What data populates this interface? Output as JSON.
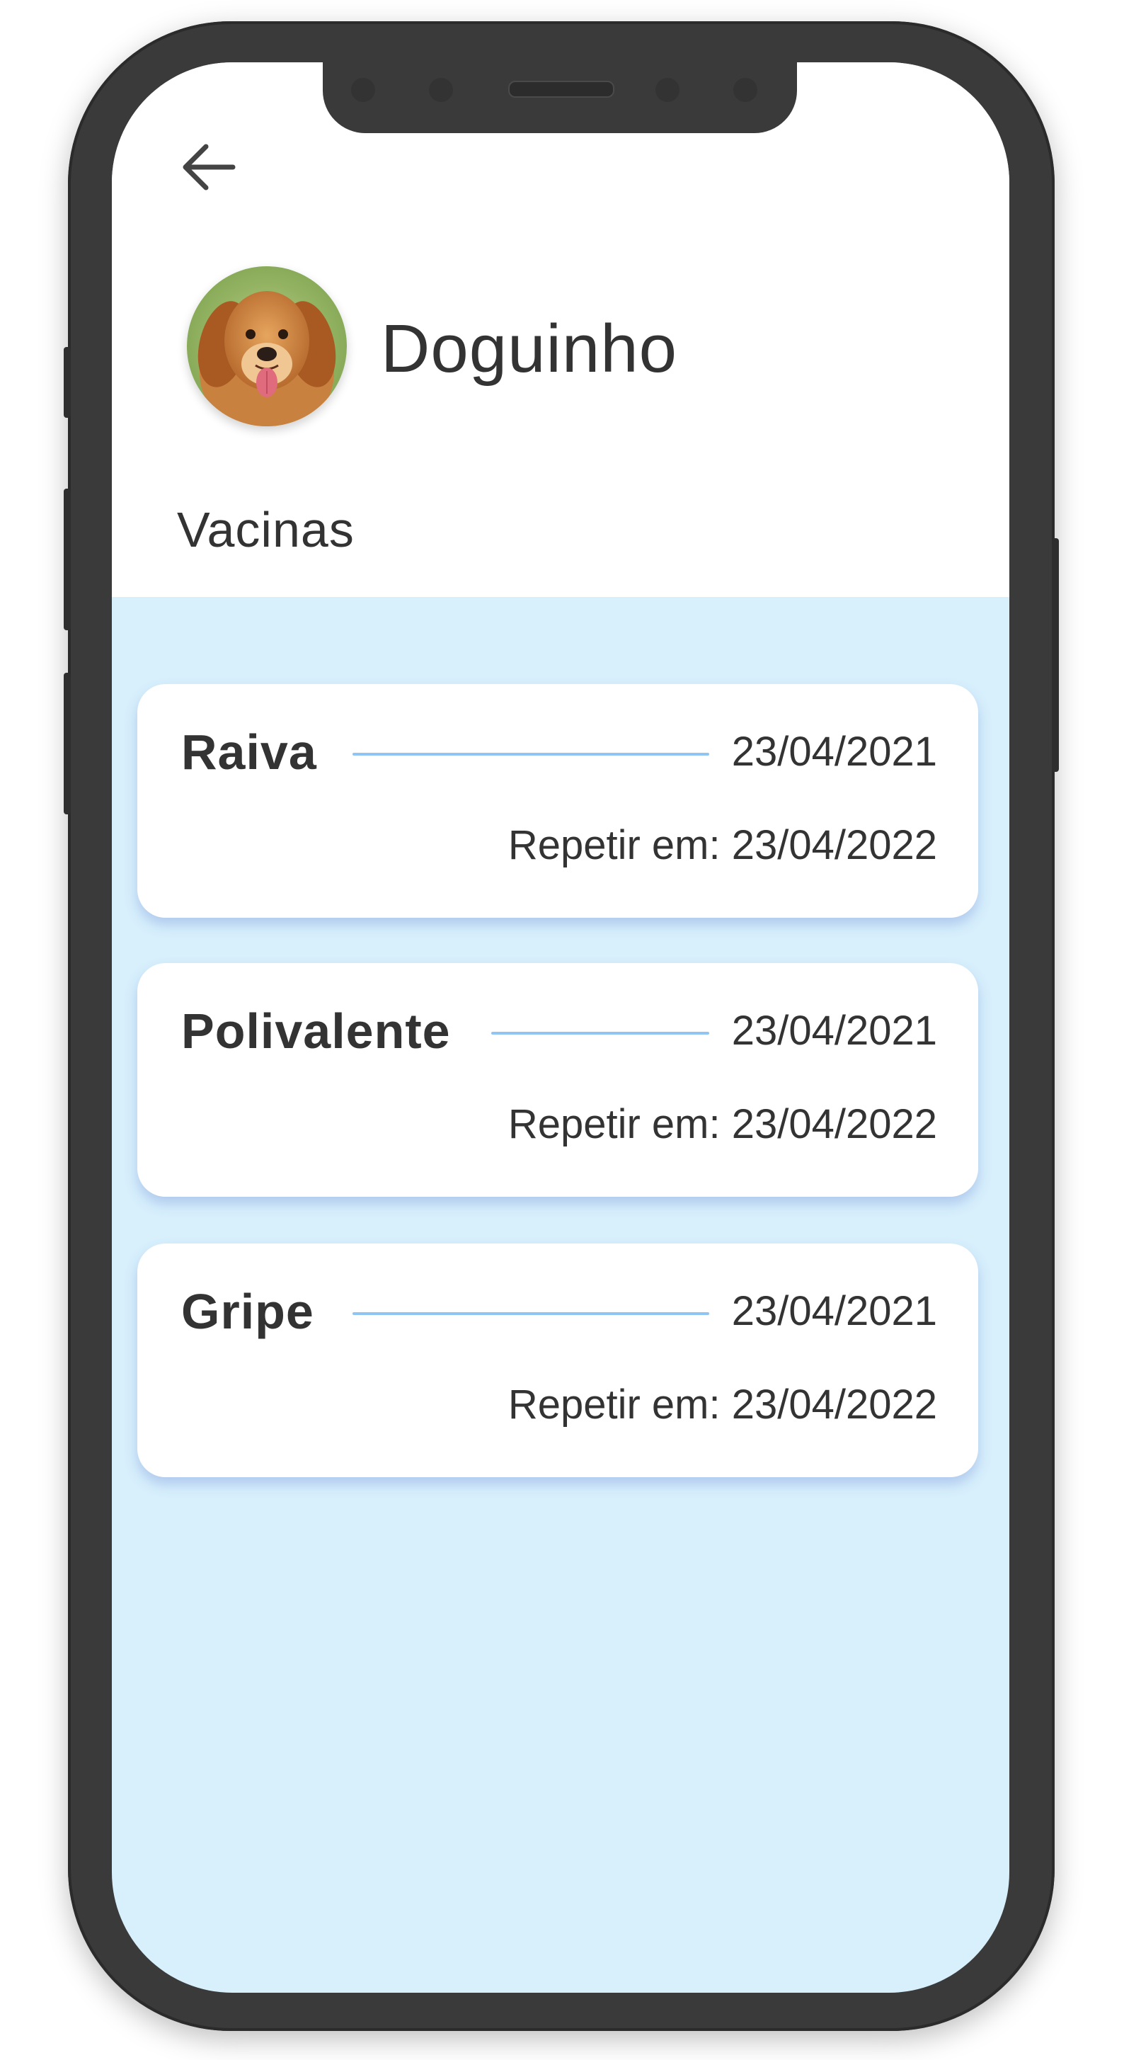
{
  "header": {
    "back_icon": "arrow-left-icon",
    "avatar_icon": "dog-photo",
    "pet_name": "Doguinho"
  },
  "section": {
    "title": "Vacinas"
  },
  "vaccines": [
    {
      "name": "Raiva",
      "date": "23/04/2021",
      "repeat": "Repetir em: 23/04/2022"
    },
    {
      "name": "Polivalente",
      "date": "23/04/2021",
      "repeat": "Repetir em: 23/04/2022"
    },
    {
      "name": "Gripe",
      "date": "23/04/2021",
      "repeat": "Repetir em: 23/04/2022"
    }
  ],
  "colors": {
    "list_background": "#d8f0fc",
    "divider_line": "#90c4f2",
    "text": "#333333",
    "phone_frame": "#3a3a3a"
  }
}
